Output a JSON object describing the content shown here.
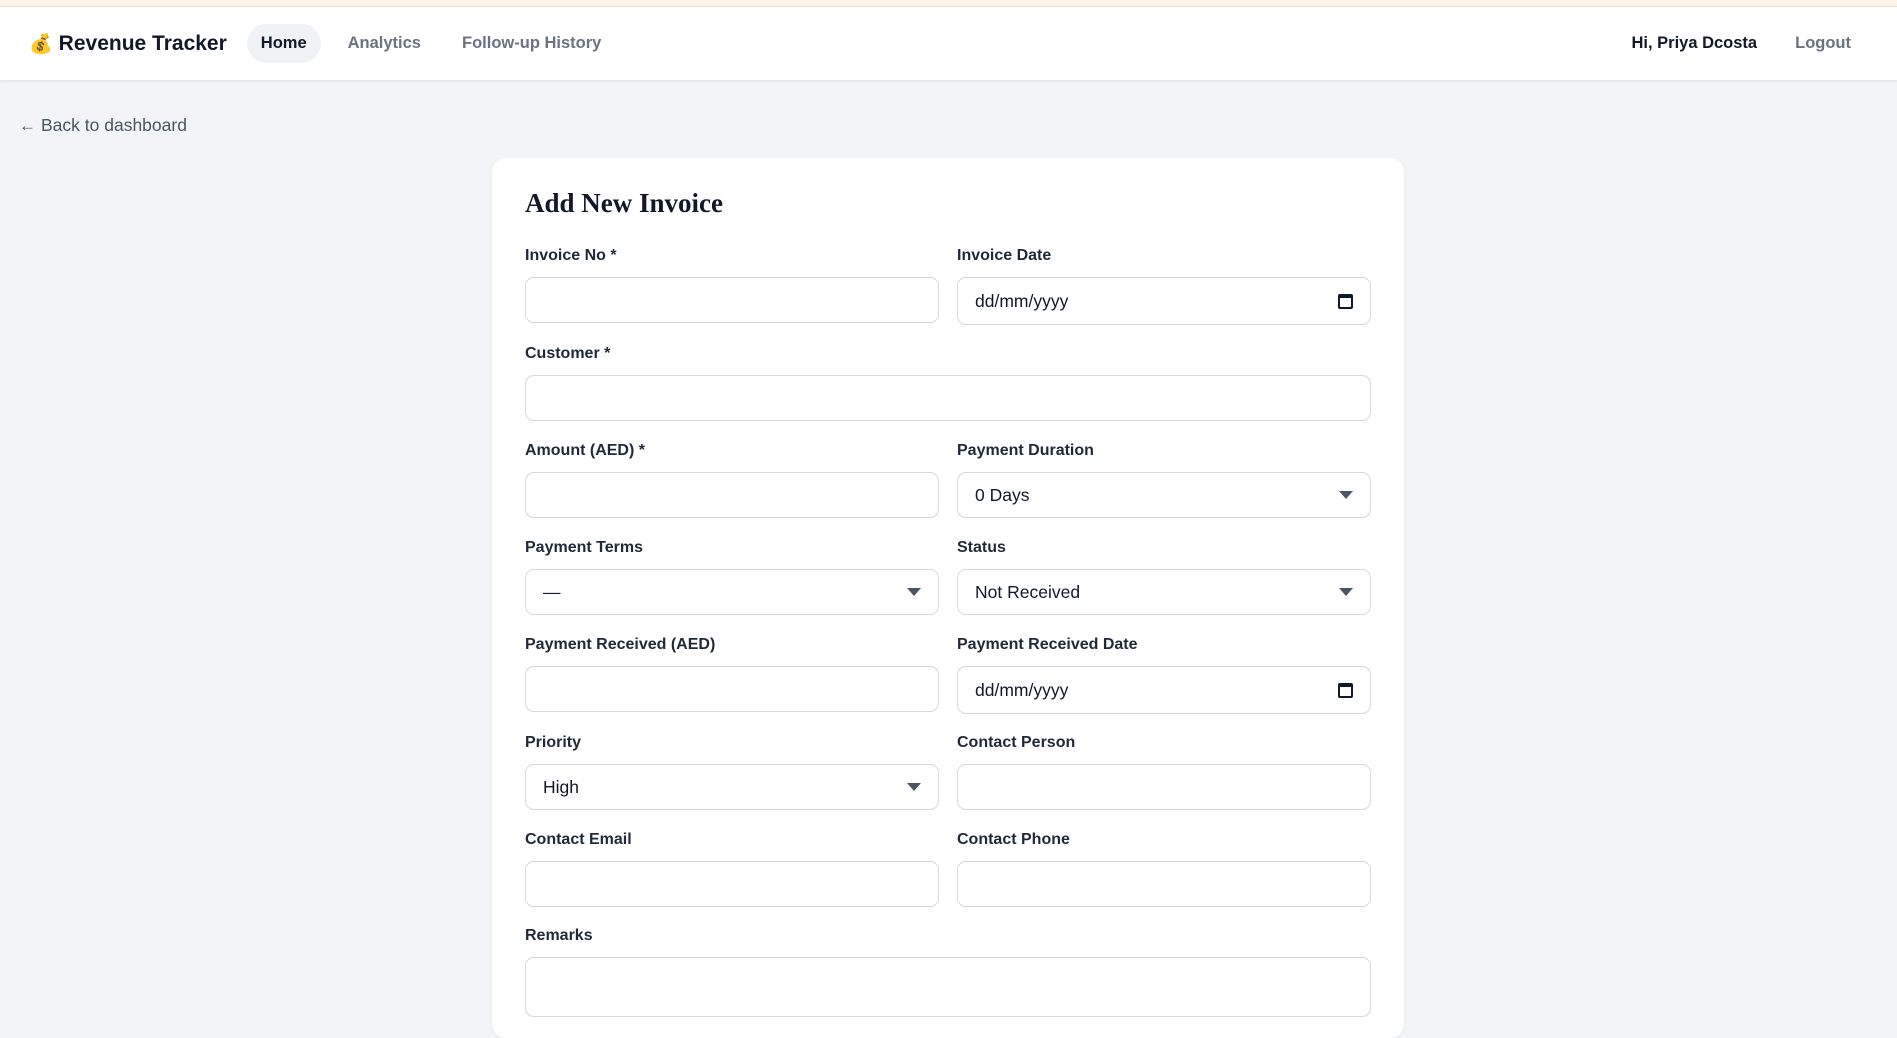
{
  "nav": {
    "brand_icon": "money-bag-icon",
    "brand": "Revenue Tracker",
    "links": [
      "Home",
      "Analytics",
      "Follow-up History"
    ],
    "active_link": "Home",
    "greeting": "Hi, Priya Dcosta",
    "logout": "Logout"
  },
  "back_link": "Back to dashboard",
  "form": {
    "title": "Add New Invoice",
    "invoice_no": {
      "label": "Invoice No *",
      "value": ""
    },
    "invoice_date": {
      "label": "Invoice Date",
      "placeholder": "dd/mm/yyyy"
    },
    "customer": {
      "label": "Customer *",
      "value": ""
    },
    "amount": {
      "label": "Amount (AED) *",
      "value": ""
    },
    "payment_duration": {
      "label": "Payment Duration",
      "value": "0 Days"
    },
    "payment_terms": {
      "label": "Payment Terms",
      "value": "—"
    },
    "status": {
      "label": "Status",
      "value": "Not Received"
    },
    "payment_received": {
      "label": "Payment Received (AED)",
      "value": ""
    },
    "payment_received_date": {
      "label": "Payment Received Date",
      "placeholder": "dd/mm/yyyy"
    },
    "priority": {
      "label": "Priority",
      "value": "High"
    },
    "contact_person": {
      "label": "Contact Person",
      "value": ""
    },
    "contact_email": {
      "label": "Contact Email",
      "value": ""
    },
    "contact_phone": {
      "label": "Contact Phone",
      "value": ""
    },
    "remarks": {
      "label": "Remarks",
      "value": ""
    }
  },
  "colors": {
    "page_bg": "#f3f4f8",
    "card_bg": "#ffffff",
    "active_pill": "#f1f2f6",
    "muted_text": "#6b7280"
  }
}
